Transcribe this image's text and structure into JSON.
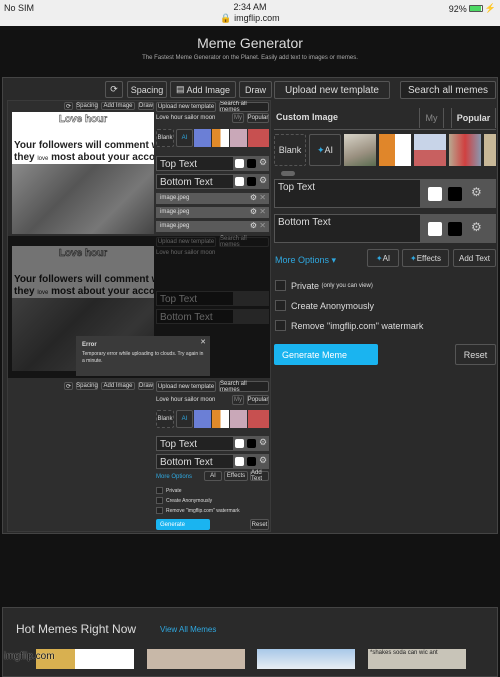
{
  "status_bar": {
    "carrier": "No SIM",
    "time": "2:34 AM",
    "url": "imgflip.com",
    "battery_percent": 92,
    "battery_label": "92%"
  },
  "header": {
    "title": "Meme Generator",
    "subtitle": "The Fastest Meme Generator on the Planet. Easily add text to images or memes."
  },
  "toolbar": {
    "rotate_icon": "rotate-icon",
    "spacing": "Spacing",
    "add_image": "Add Image",
    "draw": "Draw"
  },
  "panel": {
    "upload_template": "Upload new template",
    "search_memes": "Search all memes",
    "template_title": "Custom Image",
    "tab_my": "My",
    "tab_popular": "Popular",
    "blank": "Blank",
    "ai": "AI",
    "top_text_placeholder": "Top Text",
    "bottom_text_placeholder": "Bottom Text",
    "more_options": "More Options",
    "ai_button": "AI",
    "effects": "Effects",
    "add_text": "Add Text",
    "private_label": "Private",
    "private_note": "(only you can view)",
    "anonymous": "Create Anonymously",
    "remove_watermark": "Remove \"imgflip.com\" watermark",
    "generate": "Generate Meme",
    "reset": "Reset"
  },
  "nested": {
    "template_title": "Love hour sailor moon",
    "meme_title": "Love hour",
    "meme_line1": "Your followers will comment what",
    "meme_line2a": "they",
    "meme_line2_small": "love",
    "meme_line2b": "most about your account",
    "image_rows": [
      "image.jpeg",
      "image.jpeg",
      "image.jpeg"
    ],
    "generate": "Generate"
  },
  "error_dialog": {
    "title": "Error",
    "message": "Temporary error while uploading to clouds. Try again in a minute."
  },
  "hot": {
    "title": "Hot Memes Right Now",
    "view_all": "View All Memes",
    "thumb_caption": "*shakes soda can wic ant"
  },
  "watermark": "imgflip.com"
}
